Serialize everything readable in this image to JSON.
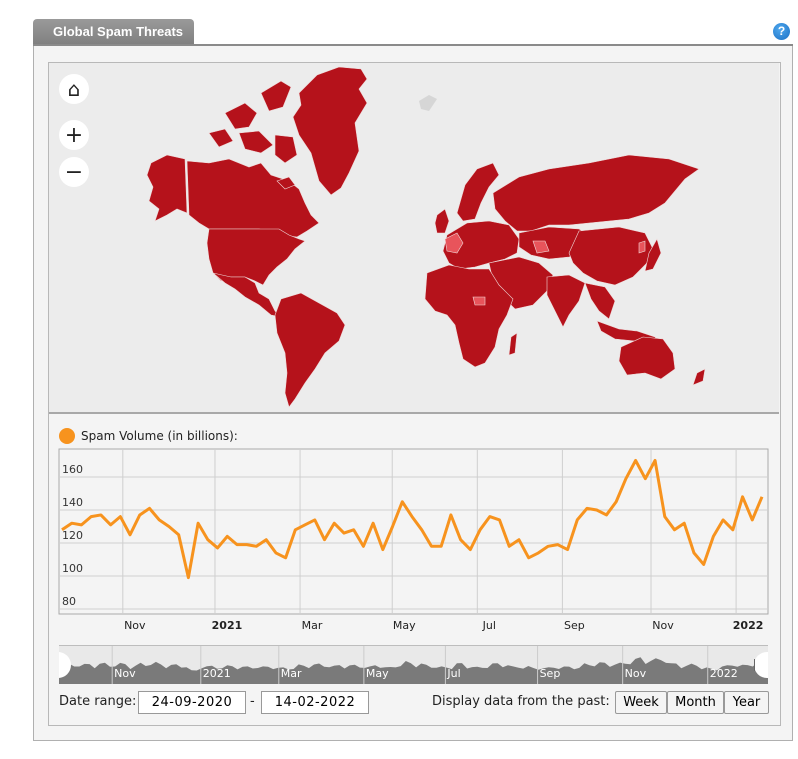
{
  "widget": {
    "tab_title": "Global Spam Threats",
    "help_icon": "?"
  },
  "map": {
    "home_icon": "⌂",
    "zoom_in_icon": "+",
    "zoom_out_icon": "−",
    "colors": {
      "land_high": "#b5121b",
      "land_low": "#e8545b",
      "water": "#ececec",
      "no_data": "#dcdcdc"
    }
  },
  "chart_data": {
    "type": "line",
    "title": "",
    "legend": [
      {
        "name": "Spam Volume (in billions):",
        "color": "#f7931e"
      }
    ],
    "legend_placement": "top-left",
    "xlabel": "",
    "ylabel": "",
    "ylim": [
      80,
      180
    ],
    "yticks": [
      80,
      100,
      120,
      140,
      160
    ],
    "xrange": [
      "24-09-2020",
      "14-02-2022"
    ],
    "xticks": [
      {
        "label": "Nov",
        "bold": false,
        "pos": 0.09
      },
      {
        "label": "2021",
        "bold": true,
        "pos": 0.22
      },
      {
        "label": "Mar",
        "bold": false,
        "pos": 0.34
      },
      {
        "label": "May",
        "bold": false,
        "pos": 0.47
      },
      {
        "label": "Jul",
        "bold": false,
        "pos": 0.59
      },
      {
        "label": "Sep",
        "bold": false,
        "pos": 0.71
      },
      {
        "label": "Nov",
        "bold": false,
        "pos": 0.835
      },
      {
        "label": "2022",
        "bold": true,
        "pos": 0.955
      }
    ],
    "grid": true,
    "series": [
      {
        "name": "Spam Volume",
        "color": "#f7931e",
        "values": [
          128,
          132,
          131,
          136,
          137,
          131,
          136,
          125,
          137,
          141,
          134,
          130,
          125,
          99,
          132,
          122,
          117,
          124,
          119,
          119,
          118,
          122,
          114,
          111,
          128,
          131,
          134,
          122,
          132,
          126,
          128,
          118,
          132,
          116,
          130,
          145,
          136,
          128,
          118,
          118,
          137,
          122,
          116,
          128,
          136,
          134,
          118,
          122,
          111,
          114,
          118,
          119,
          116,
          134,
          141,
          140,
          137,
          145,
          159,
          170,
          159,
          170,
          136,
          128,
          132,
          114,
          107,
          124,
          134,
          128,
          148,
          134,
          148
        ]
      }
    ]
  },
  "navigator": {
    "labels": [
      "Nov",
      "2021",
      "Mar",
      "May",
      "Jul",
      "Sep",
      "Nov",
      "2022"
    ]
  },
  "controls": {
    "date_range_label": "Date range:",
    "date_from": "24-09-2020",
    "date_separator": "-",
    "date_to": "14-02-2022",
    "past_label": "Display data from the past:",
    "buttons": [
      "Week",
      "Month",
      "Year"
    ]
  }
}
